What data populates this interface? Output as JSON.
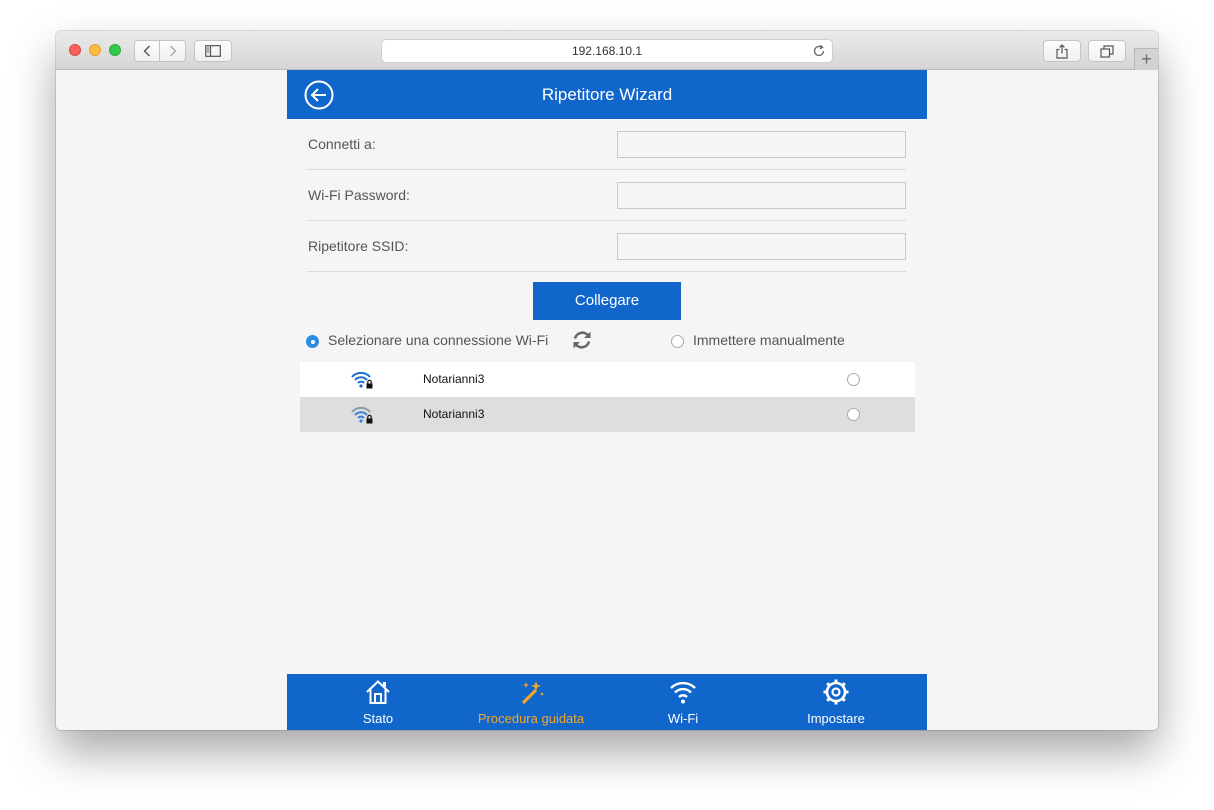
{
  "browser": {
    "url": "192.168.10.1"
  },
  "header": {
    "title": "Ripetitore Wizard",
    "color": "#1166cc"
  },
  "form": {
    "connect_to_label": "Connetti a:",
    "connect_to_value": "",
    "password_label": "Wi-Fi Password:",
    "password_value": "",
    "repeater_ssid_label": "Ripetitore SSID:",
    "repeater_ssid_value": "",
    "connect_button": "Collegare"
  },
  "mode": {
    "select_label": "Selezionare una connessione Wi-Fi",
    "manual_label": "Immettere manualmente",
    "selected": "select"
  },
  "networks": [
    {
      "name": "Notarianni3",
      "secured": true,
      "selected": false
    },
    {
      "name": "Notarianni3",
      "secured": true,
      "selected": false
    }
  ],
  "bottom_nav": [
    {
      "label": "Stato",
      "icon": "home-icon",
      "active": false
    },
    {
      "label": "Procedura guidata",
      "icon": "magic-wand-icon",
      "active": true
    },
    {
      "label": "Wi-Fi",
      "icon": "wifi-icon",
      "active": false
    },
    {
      "label": "Impostare",
      "icon": "gear-icon",
      "active": false
    }
  ],
  "colors": {
    "accent": "#1166cc",
    "active_nav": "#f5a623"
  }
}
